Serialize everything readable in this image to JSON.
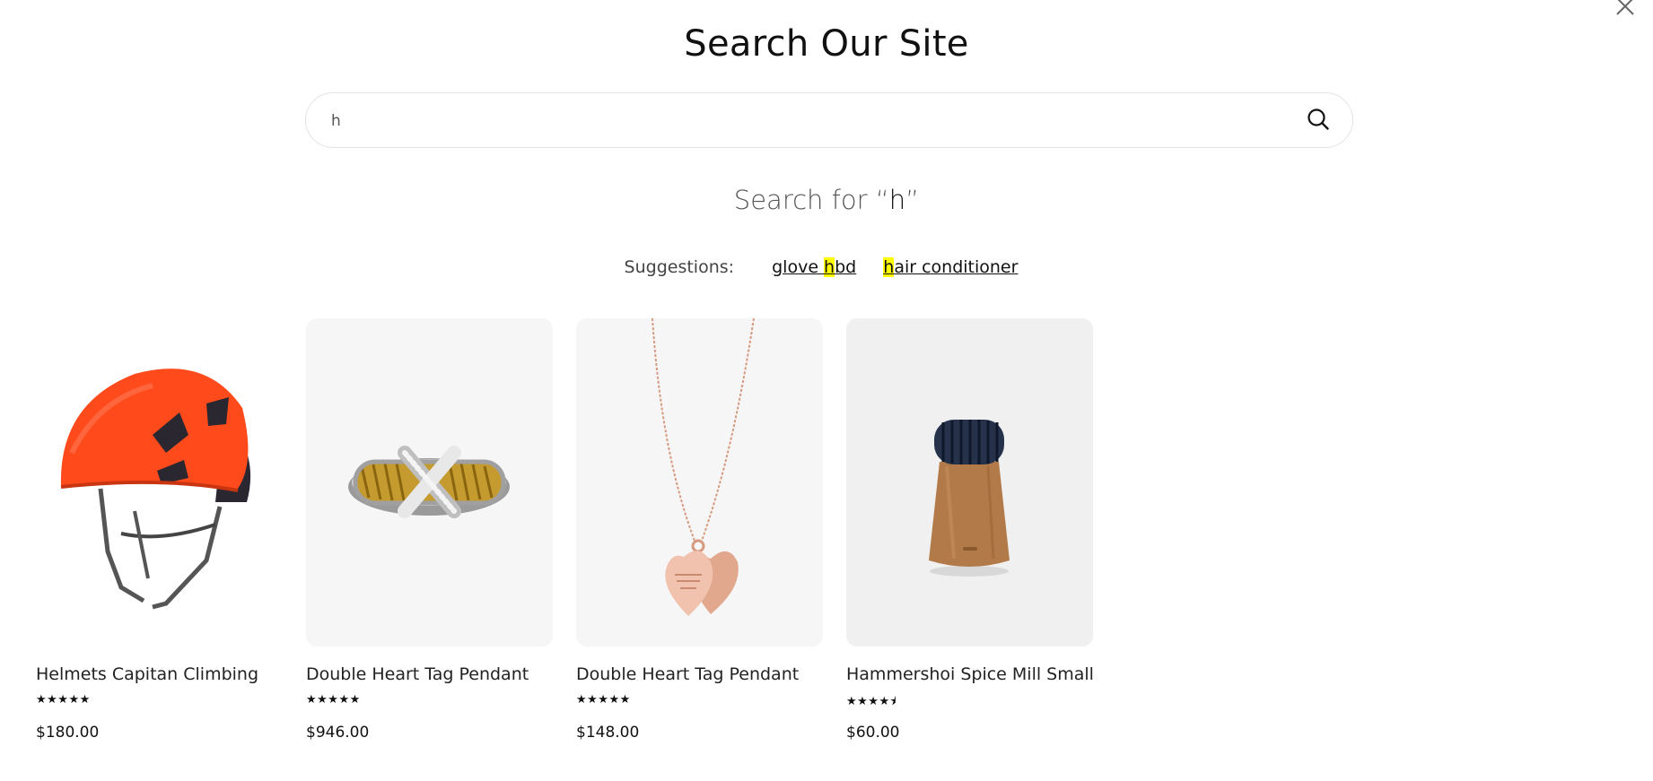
{
  "modal": {
    "title": "Search Our Site",
    "close_icon": "close-icon"
  },
  "search": {
    "value": "h",
    "placeholder": "",
    "submit_icon": "search-icon"
  },
  "results": {
    "heading_prefix": "Search for “",
    "query": "h",
    "heading_suffix": "”"
  },
  "suggestions": {
    "label": "Suggestions:",
    "items": [
      {
        "before": "glove ",
        "match": "h",
        "after": "bd"
      },
      {
        "before": "",
        "match": "h",
        "after": "air conditioner"
      }
    ]
  },
  "products": [
    {
      "name": "Helmets Capitan Climbing",
      "rating": 5,
      "stars": "★★★★★",
      "price": "$180.00",
      "image": "climbing-helmet"
    },
    {
      "name": "Double Heart Tag Pendant",
      "rating": 5,
      "stars": "★★★★★",
      "price": "$946.00",
      "image": "gold-silver-ring"
    },
    {
      "name": "Double Heart Tag Pendant",
      "rating": 5,
      "stars": "★★★★★",
      "price": "$148.00",
      "image": "heart-pendant-necklace"
    },
    {
      "name": "Hammershoi Spice Mill Small",
      "rating": 4.5,
      "stars": "★★★★⯨",
      "price": "$60.00",
      "image": "spice-mill"
    }
  ],
  "colors": {
    "highlight": "#ffff00",
    "helmet": "#ff4a1c",
    "card_bg": "#f6f6f6"
  }
}
